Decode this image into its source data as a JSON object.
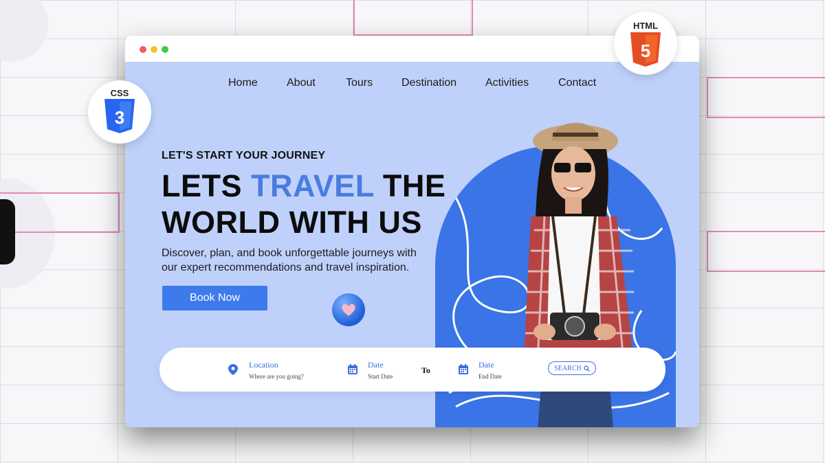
{
  "nav": {
    "items": [
      "Home",
      "About",
      "Tours",
      "Destination",
      "Activities",
      "Contact"
    ]
  },
  "hero": {
    "eyebrow": "LET'S START YOUR JOURNEY",
    "headline_part1": "LETS ",
    "headline_accent": "TRAVEL",
    "headline_part2": " THE",
    "headline_line2": "WORLD WITH US",
    "description": "Discover, plan, and book unforgettable journeys with our expert recommendations and travel inspiration.",
    "cta_label": "Book Now"
  },
  "search": {
    "location_title": "Location",
    "location_placeholder": "Where are you going?",
    "start_title": "Date",
    "start_placeholder": "Start Date",
    "to_label": "To",
    "end_title": "Date",
    "end_placeholder": "End Date",
    "button_label": "SEARCH"
  },
  "badges": {
    "css_label": "CSS",
    "css_number": "3",
    "html_label": "HTML",
    "html_number": "5"
  },
  "icons": {
    "location": "location-pin-icon",
    "calendar": "calendar-icon",
    "search": "search-icon",
    "heart": "heart-icon"
  },
  "colors": {
    "page_bg": "#bfd1fb",
    "accent": "#4a7ce0",
    "button": "#3d7aeb",
    "arch": "#3a74e6",
    "html5": "#e44d26",
    "css3": "#2965f1"
  }
}
